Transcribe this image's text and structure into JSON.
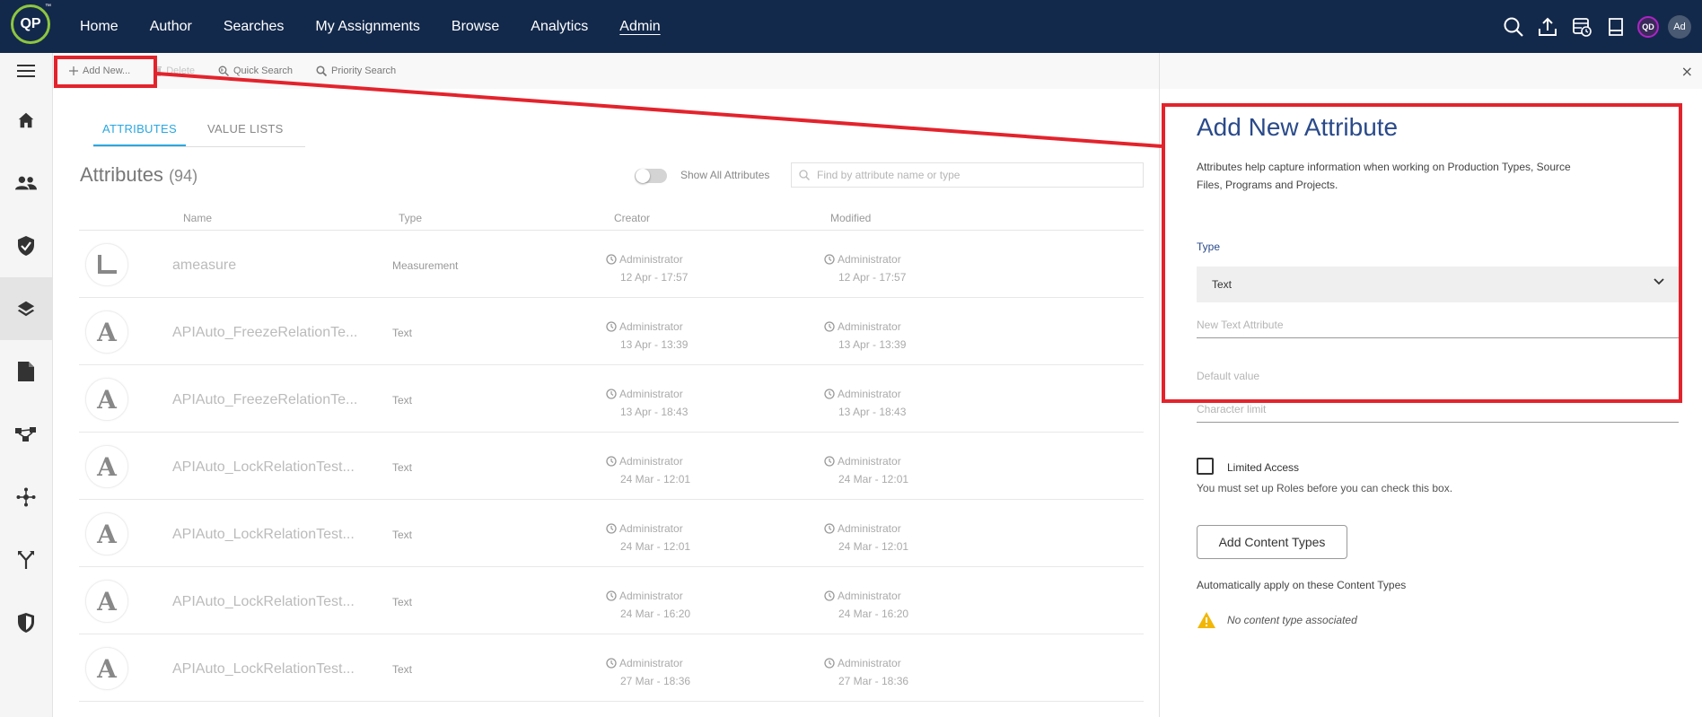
{
  "nav": {
    "logo": "QP",
    "logo_tm": "™",
    "items": [
      "Home",
      "Author",
      "Searches",
      "My Assignments",
      "Browse",
      "Analytics",
      "Admin"
    ],
    "active": "Admin",
    "avatar_qd": "QD",
    "avatar_ad": "Ad"
  },
  "toolbar": {
    "add_new": "Add New...",
    "delete": "Delete",
    "quick_search": "Quick Search",
    "priority_search": "Priority Search"
  },
  "tabs": [
    "ATTRIBUTES",
    "VALUE LISTS"
  ],
  "page": {
    "title": "Attributes",
    "count": "(94)",
    "toggle_label": "Show All Attributes",
    "search_placeholder": "Find by attribute name or type"
  },
  "table": {
    "headers": [
      "Name",
      "Type",
      "Creator",
      "Modified"
    ],
    "rows": [
      {
        "icon": "ruler-icon",
        "name": "ameasure",
        "type": "Measurement",
        "creator": "Administrator",
        "created": "12 Apr - 17:57",
        "modifier": "Administrator",
        "modified": "12 Apr - 17:57"
      },
      {
        "icon": "text-a-icon",
        "name": "APIAuto_FreezeRelationTe...",
        "type": "Text",
        "creator": "Administrator",
        "created": "13 Apr - 13:39",
        "modifier": "Administrator",
        "modified": "13 Apr - 13:39"
      },
      {
        "icon": "text-a-icon",
        "name": "APIAuto_FreezeRelationTe...",
        "type": "Text",
        "creator": "Administrator",
        "created": "13 Apr - 18:43",
        "modifier": "Administrator",
        "modified": "13 Apr - 18:43"
      },
      {
        "icon": "text-a-icon",
        "name": "APIAuto_LockRelationTest...",
        "type": "Text",
        "creator": "Administrator",
        "created": "24 Mar - 12:01",
        "modifier": "Administrator",
        "modified": "24 Mar - 12:01"
      },
      {
        "icon": "text-a-icon",
        "name": "APIAuto_LockRelationTest...",
        "type": "Text",
        "creator": "Administrator",
        "created": "24 Mar - 12:01",
        "modifier": "Administrator",
        "modified": "24 Mar - 12:01"
      },
      {
        "icon": "text-a-icon",
        "name": "APIAuto_LockRelationTest...",
        "type": "Text",
        "creator": "Administrator",
        "created": "24 Mar - 16:20",
        "modifier": "Administrator",
        "modified": "24 Mar - 16:20"
      },
      {
        "icon": "text-a-icon",
        "name": "APIAuto_LockRelationTest...",
        "type": "Text",
        "creator": "Administrator",
        "created": "27 Mar - 18:36",
        "modifier": "Administrator",
        "modified": "27 Mar - 18:36"
      }
    ]
  },
  "panel": {
    "close": "×",
    "title": "Add New Attribute",
    "description": "Attributes help capture information when working on Production Types, Source Files, Programs and Projects.",
    "type_label": "Type",
    "type_value": "Text",
    "name_placeholder": "New Text Attribute",
    "default_placeholder": "Default value",
    "limit_placeholder": "Character limit",
    "limited_access_label": "Limited Access",
    "roles_help": "You must set up Roles before you can check this box.",
    "add_content_types": "Add Content Types",
    "auto_apply": "Automatically apply on these Content Types",
    "no_content": "No content type associated"
  },
  "colors": {
    "nav_bg": "#13294b",
    "accent_tab": "#2aa7e0",
    "panel_title": "#2a4a8a",
    "annotation_red": "#e3232c",
    "warning": "#f2b705"
  }
}
